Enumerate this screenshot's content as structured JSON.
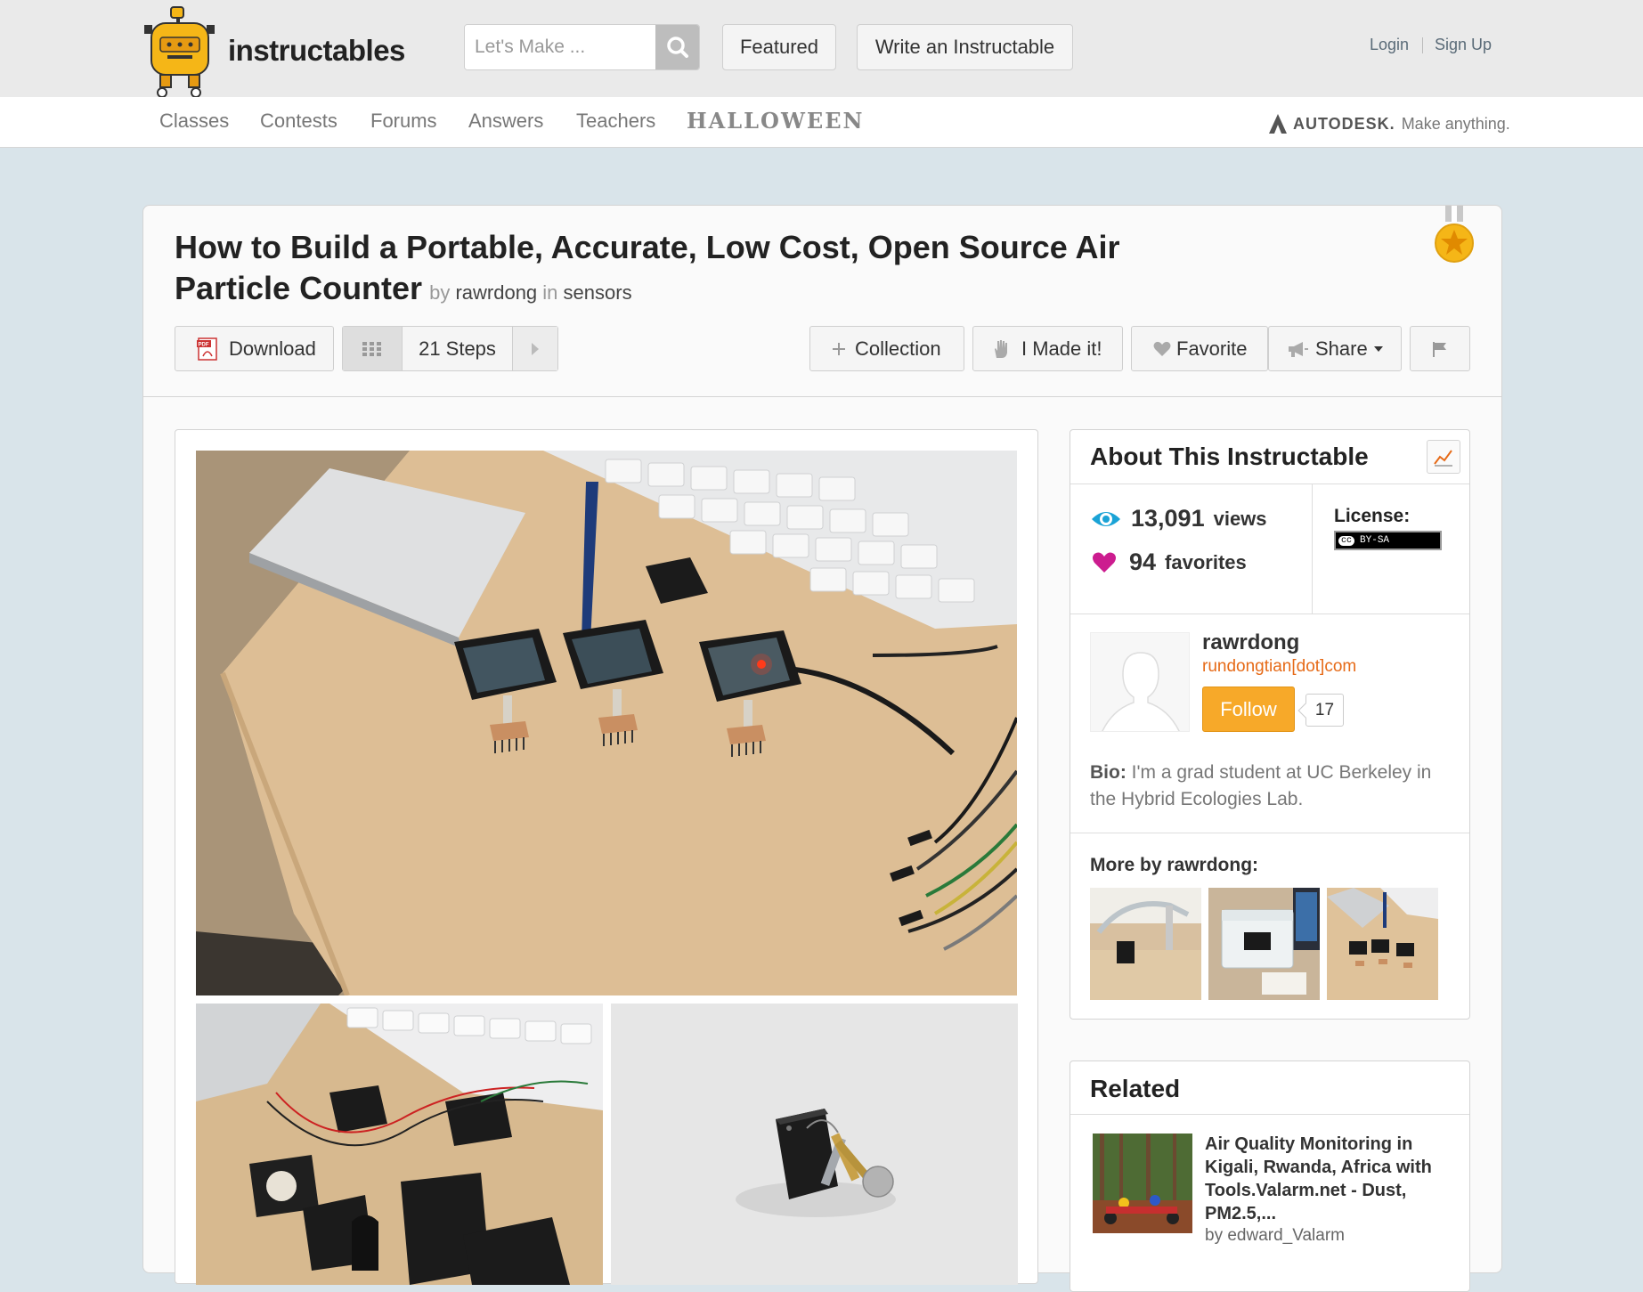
{
  "header": {
    "site_name": "instructables",
    "search_placeholder": "Let's Make ...",
    "featured_label": "Featured",
    "write_label": "Write an Instructable",
    "login_label": "Login",
    "signup_label": "Sign Up"
  },
  "nav": {
    "items": [
      "Classes",
      "Contests",
      "Forums",
      "Answers",
      "Teachers"
    ],
    "halloween": "HALLOWEEN",
    "autodesk_brand": "AUTODESK.",
    "autodesk_tagline": "Make anything."
  },
  "article": {
    "title": "How to Build a Portable, Accurate, Low Cost, Open Source Air Particle Counter",
    "by_word": "by",
    "author": "rawrdong",
    "in_word": "in",
    "category": "sensors",
    "actions": {
      "download": "Download",
      "pdf_badge": "PDF",
      "steps": "21 Steps",
      "collection": "Collection",
      "made_it": "I Made it!",
      "favorite": "Favorite",
      "share": "Share"
    }
  },
  "about": {
    "heading": "About This Instructable",
    "views_count": "13,091",
    "views_label": "views",
    "favorites_count": "94",
    "favorites_label": "favorites",
    "license_label": "License:",
    "license_badge": "BY-SA",
    "license_cc": "cc",
    "author_name": "rawrdong",
    "author_email": "rundongtian[dot]com",
    "follow_label": "Follow",
    "follower_count": "17",
    "bio_label": "Bio:",
    "bio_text": "I'm a grad student at UC Berkeley in the Hybrid Ecologies Lab.",
    "more_label": "More by rawrdong:"
  },
  "related": {
    "heading": "Related",
    "item_title": "Air Quality Monitoring in Kigali, Rwanda, Africa with Tools.Valarm.net - Dust, PM2.5,...",
    "item_by": "by edward_Valarm"
  },
  "colors": {
    "accent_orange": "#f7a929",
    "link_orange": "#e66a17",
    "views_icon": "#1aa3d6",
    "favorite_heart": "#cc1c8f",
    "page_bg": "#d9e4ea"
  },
  "icons": [
    "robot-logo-icon",
    "search-icon",
    "pdf-icon",
    "grid-icon",
    "chevron-right-icon",
    "plus-icon",
    "hand-icon",
    "heart-icon",
    "megaphone-icon",
    "caret-down-icon",
    "flag-icon",
    "medal-icon",
    "stats-icon",
    "eye-icon",
    "autodesk-logo-icon"
  ]
}
